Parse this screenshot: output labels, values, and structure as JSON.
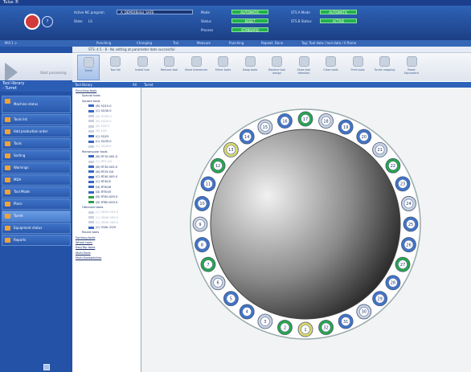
{
  "app": {
    "title": "Tulus ®"
  },
  "header": {
    "program_label": "Active NC program",
    "program_value": "_A_DEMO(Beta)_SAFE",
    "state_label": "State",
    "state_value": "LS",
    "mode_label": "Mode",
    "mode_value": "AUTOMATIC",
    "status_label": "Status",
    "status_value": "RESET",
    "process_label": "Process",
    "process_value": "STANDARD",
    "sts_a_label": "STS A Mode",
    "sts_a_value": "AUTOMATIC",
    "sts_b_label": "STS B Status",
    "sts_b_value": "ACTIVE",
    "logo_icon": "machine-icon",
    "help_label": "?"
  },
  "subheader": {
    "machine": "Mill 1 >",
    "items": [
      "Punching",
      "Changing",
      "Trai",
      "Measure",
      "Punching",
      "Repeat: Done",
      "Tag: Tool data / tool data / 6 flame"
    ]
  },
  "left": {
    "mode_text": "Start processing",
    "library_title": "Tool library",
    "library_sub": "- Turret",
    "menu": [
      {
        "label": "Machine status",
        "big": true,
        "selected": false
      },
      {
        "label": "Tools list",
        "big": false,
        "selected": false
      },
      {
        "label": "Add production order",
        "big": false,
        "selected": false
      },
      {
        "label": "Tools",
        "big": false,
        "selected": false
      },
      {
        "label": "Sorting",
        "big": false,
        "selected": false
      },
      {
        "label": "Warnings",
        "big": false,
        "selected": false
      },
      {
        "label": "MDA",
        "big": false,
        "selected": false
      },
      {
        "label": "Tool Mode",
        "big": false,
        "selected": false
      },
      {
        "label": "Plans",
        "big": false,
        "selected": false
      },
      {
        "label": "Turret",
        "big": false,
        "selected": true
      },
      {
        "label": "Equipment status",
        "big": false,
        "selected": false
      },
      {
        "label": "Reports",
        "big": false,
        "selected": false
      }
    ],
    "bottom_icon": "report-icon"
  },
  "infobar": {
    "text": "STS: 4.5 - 8 - No setting at parameter date successful"
  },
  "toolbar": [
    {
      "label": "Turret",
      "active": true
    },
    {
      "label": "Tool list",
      "active": false
    },
    {
      "label": "Install tool",
      "active": false
    },
    {
      "label": "Remove tool",
      "active": false
    },
    {
      "label": "Show tolerances",
      "active": false
    },
    {
      "label": "Mirror tools",
      "active": false
    },
    {
      "label": "Swap tools",
      "active": false
    },
    {
      "label": "Replace tool assign",
      "active": false
    },
    {
      "label": "Show tool direction",
      "active": false
    },
    {
      "label": "Clear tools",
      "active": false
    },
    {
      "label": "Print tools",
      "active": false
    },
    {
      "label": "Turret mapping",
      "active": false
    },
    {
      "label": "Reset Equivalent",
      "active": false
    }
  ],
  "tree": {
    "title": "Tool library",
    "filter_label": "All",
    "items": [
      {
        "text": "Punching tools",
        "indent": 0,
        "link": true,
        "gray": false
      },
      {
        "text": "Special tools",
        "indent": 1,
        "link": false,
        "gray": false
      },
      {
        "text": "Square tools",
        "indent": 1,
        "link": false,
        "gray": false
      },
      {
        "text": "(B) SQ15.0",
        "indent": 2,
        "link": false,
        "gray": false,
        "color": "#3a66c6"
      },
      {
        "text": "(C) SQ30.0",
        "indent": 2,
        "link": false,
        "gray": false,
        "color": "#3a66c6"
      },
      {
        "text": "(D) SQ50.0",
        "indent": 2,
        "link": false,
        "gray": true,
        "color": "#c9d2df"
      },
      {
        "text": "(B) SQ20.0",
        "indent": 2,
        "link": false,
        "gray": true,
        "color": "#c9d2df"
      },
      {
        "text": "(B) SQ5.0",
        "indent": 2,
        "link": false,
        "gray": true,
        "color": "#c9d2df"
      },
      {
        "text": "(B) SQ5",
        "indent": 2,
        "link": false,
        "gray": true,
        "color": "#c9d2df"
      },
      {
        "text": "(C) SQ25",
        "indent": 2,
        "link": false,
        "gray": false,
        "color": "#3a66c6"
      },
      {
        "text": "(C) SQ35.0",
        "indent": 2,
        "link": false,
        "gray": false,
        "color": "#3a66c6"
      },
      {
        "text": "(C) SQ40.0",
        "indent": 2,
        "link": false,
        "gray": true,
        "color": "#c9d2df"
      },
      {
        "text": "Rectangular tools",
        "indent": 1,
        "link": false,
        "gray": false
      },
      {
        "text": "(B) RT10.0X2.0",
        "indent": 2,
        "link": false,
        "gray": false,
        "color": "#3a66c6"
      },
      {
        "text": "(C) RT5.0/5",
        "indent": 2,
        "link": false,
        "gray": true,
        "color": "#c9d2df"
      },
      {
        "text": "(B) RT30.0X3.0",
        "indent": 2,
        "link": false,
        "gray": false,
        "color": "#3a66c6"
      },
      {
        "text": "(B) RT25.0/4",
        "indent": 2,
        "link": false,
        "gray": false,
        "color": "#3a66c6"
      },
      {
        "text": "(C) RT40.0X5.0",
        "indent": 2,
        "link": false,
        "gray": false,
        "color": "#3a66c6"
      },
      {
        "text": "(C) RT40/5",
        "indent": 2,
        "link": false,
        "gray": false,
        "color": "#3a66c6"
      },
      {
        "text": "(D) RT40/6",
        "indent": 2,
        "link": false,
        "gray": false,
        "color": "#3a66c6"
      },
      {
        "text": "(D) RT50/5",
        "indent": 2,
        "link": false,
        "gray": false,
        "color": "#3a66c6"
      },
      {
        "text": "(D) RT40.0X5.0",
        "indent": 2,
        "link": false,
        "gray": false,
        "color": "#2fa04a"
      },
      {
        "text": "(D) RT80.0X5.0",
        "indent": 2,
        "link": false,
        "gray": false,
        "color": "#2fa04a"
      },
      {
        "text": "Oblround tools",
        "indent": 1,
        "link": false,
        "gray": false
      },
      {
        "text": "(C) OB20.0X5.0",
        "indent": 2,
        "link": false,
        "gray": true,
        "color": "#c9d2df"
      },
      {
        "text": "(C) OB40.0X5.0",
        "indent": 2,
        "link": false,
        "gray": true,
        "color": "#c9d2df"
      },
      {
        "text": "(C) OB50.0X8.0",
        "indent": 2,
        "link": false,
        "gray": true,
        "color": "#c9d2df"
      },
      {
        "text": "(C) OVAL 20/5",
        "indent": 2,
        "link": false,
        "gray": false,
        "color": "#3a66c6"
      },
      {
        "text": "Round tools",
        "indent": 1,
        "link": false,
        "gray": false
      },
      {
        "text": "Forming tools",
        "indent": 0,
        "link": true,
        "gray": false
      },
      {
        "text": "Wheel tools",
        "indent": 0,
        "link": true,
        "gray": false
      },
      {
        "text": "EasyTap tools",
        "indent": 0,
        "link": true,
        "gray": false
      },
      {
        "text": "Multi-Tools",
        "indent": 0,
        "link": true,
        "gray": false
      },
      {
        "text": "Multi-Toolswitches",
        "indent": 0,
        "link": true,
        "gray": false
      }
    ]
  },
  "turret": {
    "title": "Turret",
    "stations": [
      "1",
      "2",
      "3",
      "4",
      "5",
      "6",
      "7",
      "8",
      "9",
      "10",
      "11",
      "12",
      "13",
      "14",
      "15",
      "16",
      "17",
      "18",
      "19",
      "20",
      "21",
      "22",
      "23",
      "24",
      "25",
      "26",
      "27",
      "28",
      "29",
      "30",
      "31",
      "32"
    ]
  },
  "colors": {
    "blue": "#3f74c8",
    "green": "#27a745",
    "gray": "#c9d2df",
    "yellow": "#dcd96a"
  }
}
